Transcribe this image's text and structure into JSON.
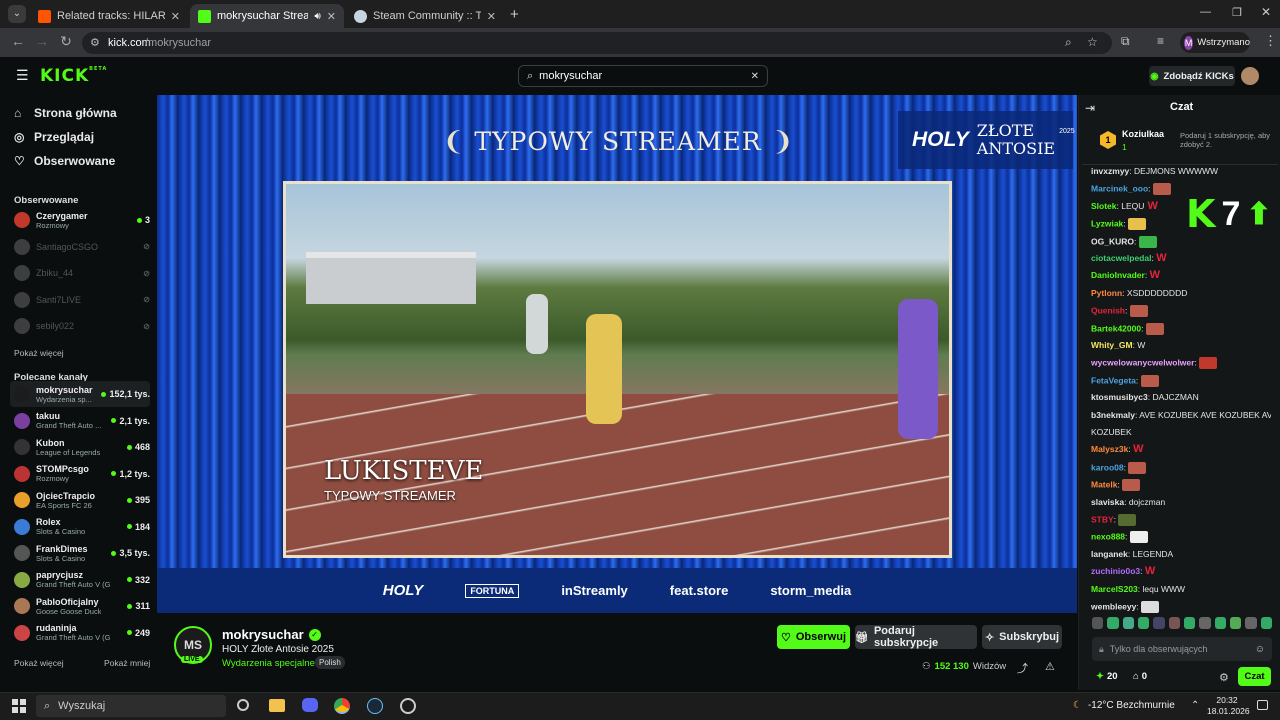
{
  "browser": {
    "tabs": [
      {
        "title": "Related tracks: HILARY INCOGNITO",
        "color": "#ff5500"
      },
      {
        "title": "mokrysuchar Stream - Watch",
        "color": "#53fc18"
      },
      {
        "title": "Steam Community :: Trade Offers",
        "color": "#1b2838"
      }
    ],
    "url_host": "kick.com",
    "url_path": "/mokrysuchar",
    "profile_label": "Wstrzymano",
    "profile_initial": "M"
  },
  "site": {
    "logo": "KICK",
    "beta": "BETA",
    "search_value": "mokrysuchar",
    "kicks_button": "Zdobądź KICKs"
  },
  "sidebar": {
    "nav": [
      {
        "label": "Strona główna",
        "icon": "home-icon"
      },
      {
        "label": "Przeglądaj",
        "icon": "compass-icon"
      },
      {
        "label": "Obserwowane",
        "icon": "heart-icon"
      }
    ],
    "followed_title": "Obserwowane",
    "followed": [
      {
        "name": "Czerygamer",
        "category": "Rozmowy",
        "viewers": "3",
        "live": true,
        "color": "#c0392b"
      },
      {
        "name": "SantiagoCSGO",
        "category": "",
        "viewers": "",
        "live": false,
        "color": "#888"
      },
      {
        "name": "Zbiku_44",
        "category": "",
        "viewers": "",
        "live": false,
        "color": "#888"
      },
      {
        "name": "Santi7LIVE",
        "category": "",
        "viewers": "",
        "live": false,
        "color": "#888"
      },
      {
        "name": "sebily022",
        "category": "",
        "viewers": "",
        "live": false,
        "color": "#888"
      }
    ],
    "show_more": "Pokaż więcej",
    "recommended_title": "Polecane kanały",
    "recommended": [
      {
        "name": "mokrysuchar",
        "category": "Wydarzenia sp...",
        "viewers": "152,1 tys.",
        "color": "#1c1c1c"
      },
      {
        "name": "takuu",
        "category": "Grand Theft Auto ...",
        "viewers": "2,1 tys.",
        "color": "#7b3fa0"
      },
      {
        "name": "Kubon",
        "category": "League of Legends",
        "viewers": "468",
        "color": "#333"
      },
      {
        "name": "STOMPcsgo",
        "category": "Rozmowy",
        "viewers": "1,2 tys.",
        "color": "#b33"
      },
      {
        "name": "OjciecTrapcio",
        "category": "EA Sports FC 26",
        "viewers": "395",
        "color": "#e8a02b"
      },
      {
        "name": "Rolex",
        "category": "Slots & Casino",
        "viewers": "184",
        "color": "#3a7bd5"
      },
      {
        "name": "FrankDimes",
        "category": "Slots & Casino",
        "viewers": "3,5 tys.",
        "color": "#555"
      },
      {
        "name": "paprycjusz",
        "category": "Grand Theft Auto V (G...",
        "viewers": "332",
        "color": "#8a4"
      },
      {
        "name": "PabloOficjalny",
        "category": "Goose Goose Duck",
        "viewers": "311",
        "color": "#a75"
      },
      {
        "name": "rudaninja",
        "category": "Grand Theft Auto V (G...",
        "viewers": "249",
        "color": "#c44"
      }
    ],
    "show_more2": "Pokaż więcej",
    "show_less": "Pokaż mniej"
  },
  "video": {
    "banner": "TYPOWY STREAMER",
    "event_logo": "HOLY",
    "event_title_1": "ZŁOTE",
    "event_title_2": "ANTOSIE",
    "event_year": "2025",
    "lower_third_name": "LUKISTEVE",
    "lower_third_sub": "TYPOWY STREAMER",
    "sponsors": [
      "HOLY",
      "FORTUNA",
      "inStreamly",
      "feat.store",
      "storm_media"
    ]
  },
  "channel": {
    "initials": "MS",
    "live": "LIVE",
    "name": "mokrysuchar",
    "title": "HOLY Złote Antosie 2025",
    "category": "Wydarzenia specjalne",
    "language": "Polish",
    "follow": "Obserwuj",
    "gift": "Podaruj subskrypcje",
    "subscribe": "Subskrybuj",
    "viewers": "152 130",
    "viewers_label": "Widzów"
  },
  "chat": {
    "title": "Czat",
    "leader_name": "Koziulkaa",
    "leader_count": "1",
    "leader_hint": "Podaruj 1 subskrypcję, aby zdobyć 2.",
    "kick_overlay": "7",
    "messages": [
      {
        "user": "invxzmyy",
        "text": "DEJMONS WWWWW",
        "color": "#e4e4e4"
      },
      {
        "user": "Marcinek_ooo",
        "text": "",
        "emote": "#b85b4a",
        "color": "#4aa3df"
      },
      {
        "user": "Slotek",
        "text": "LEQU",
        "w": true,
        "color": "#53fc18"
      },
      {
        "user": "Lyzwiak",
        "text": "",
        "emote": "#e6c04a",
        "color": "#53fc18"
      },
      {
        "user": "OG_KURO",
        "text": "",
        "emote": "#3bb54a",
        "color": "#e4e4e4"
      },
      {
        "user": "ciotacwelpedal",
        "text": "",
        "w": true,
        "color": "#3bd16f"
      },
      {
        "user": "DanioInvader",
        "text": "",
        "w": true,
        "color": "#53fc18"
      },
      {
        "user": "Pytlonn",
        "text": "XSDDDDDDDD",
        "color": "#ff8a3d"
      },
      {
        "user": "Quenish",
        "text": "",
        "emote": "#b85b4a",
        "color": "#e5233a"
      },
      {
        "user": "Bartek42000",
        "text": "",
        "emote": "#b85b4a",
        "color": "#53fc18"
      },
      {
        "user": "Whity_GM",
        "text": "W",
        "color": "#f5e663"
      },
      {
        "user": "wycwelowanycwelwolwer",
        "text": "",
        "emote": "#c0392b",
        "color": "#e8a0ff"
      },
      {
        "user": "FetaVegeta",
        "text": "",
        "emote": "#b85b4a",
        "color": "#4aa3df"
      },
      {
        "user": "ktosmusibyc3",
        "text": "DAJCZMAN",
        "color": "#e4e4e4"
      },
      {
        "user": "b3nekmaly",
        "text": "AVE KOZUBEK AVE KOZUBEK AVE",
        "color": "#e4e4e4"
      },
      {
        "user": "",
        "text": "KOZUBEK",
        "color": "#e4e4e4"
      },
      {
        "user": "Malysz3k",
        "text": "",
        "w": true,
        "color": "#ff8a3d"
      },
      {
        "user": "karoo08",
        "text": "",
        "emote": "#b85b4a",
        "color": "#4aa3df"
      },
      {
        "user": "Matelk",
        "text": "",
        "emote": "#b85b4a",
        "color": "#ff8a3d"
      },
      {
        "user": "slaviska",
        "text": "dojczman",
        "color": "#e4e4e4"
      },
      {
        "user": "STBY",
        "text": "",
        "emote": "#556b2f",
        "color": "#e5233a"
      },
      {
        "user": "nexo888",
        "text": "",
        "emote": "#eee",
        "color": "#53fc18"
      },
      {
        "user": "langanek",
        "text": "LEGENDA",
        "color": "#e4e4e4"
      },
      {
        "user": "zuchinio0o3",
        "text": "",
        "w": true,
        "color": "#b36bff"
      },
      {
        "user": "MarcelS203",
        "text": "lequ WWW",
        "color": "#53fc18"
      },
      {
        "user": "wembleeyy",
        "text": "",
        "emote": "#ddd",
        "color": "#e4e4e4"
      }
    ],
    "input_placeholder": "Tylko dla obserwujących",
    "points": "20",
    "gifts": "0",
    "send": "Czat"
  },
  "taskbar": {
    "search": "Wyszukaj",
    "weather": "-12°C  Bezchmurnie",
    "time": "20:32",
    "date": "18.01.2026"
  }
}
